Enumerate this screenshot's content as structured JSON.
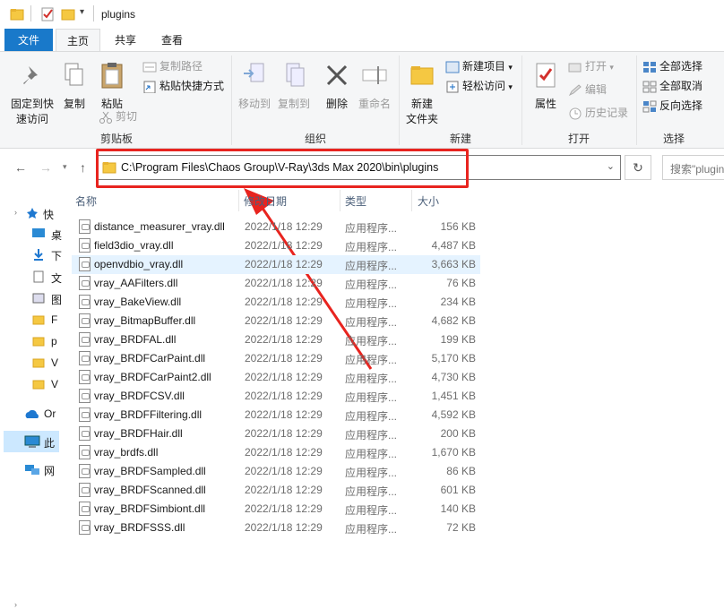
{
  "window": {
    "title": "plugins"
  },
  "tabs": {
    "file": "文件",
    "home": "主页",
    "share": "共享",
    "view": "查看"
  },
  "ribbon": {
    "pin": "固定到快\n速访问",
    "copy": "复制",
    "paste": "粘贴",
    "copy_path": "复制路径",
    "paste_shortcut": "粘贴快捷方式",
    "cut": "剪切",
    "group_clipboard": "剪贴板",
    "move_to": "移动到",
    "copy_to": "复制到",
    "delete": "删除",
    "rename": "重命名",
    "group_organize": "组织",
    "new_item": "新建项目",
    "easy_access": "轻松访问",
    "new_folder": "新建\n文件夹",
    "group_new": "新建",
    "properties": "属性",
    "open": "打开",
    "edit": "编辑",
    "history": "历史记录",
    "group_open": "打开",
    "select_all": "全部选择",
    "select_none": "全部取消",
    "invert_selection": "反向选择",
    "group_select": "选择"
  },
  "address": {
    "path": "C:\\Program Files\\Chaos Group\\V-Ray\\3ds Max 2020\\bin\\plugins"
  },
  "search": {
    "placeholder": "搜索\"plugins\""
  },
  "nav": {
    "items": [
      "快",
      "桌",
      "下",
      "文",
      "图",
      "F",
      "p",
      "V",
      "V",
      "Or",
      "此",
      "网"
    ]
  },
  "columns": {
    "name": "名称",
    "date": "修改日期",
    "type": "类型",
    "size": "大小"
  },
  "files": [
    {
      "name": "distance_measurer_vray.dll",
      "date": "2022/1/18 12:29",
      "type": "应用程序...",
      "size": "156 KB"
    },
    {
      "name": "field3dio_vray.dll",
      "date": "2022/1/18 12:29",
      "type": "应用程序...",
      "size": "4,487 KB"
    },
    {
      "name": "openvdbio_vray.dll",
      "date": "2022/1/18 12:29",
      "type": "应用程序...",
      "size": "3,663 KB"
    },
    {
      "name": "vray_AAFilters.dll",
      "date": "2022/1/18 12:29",
      "type": "应用程序...",
      "size": "76 KB"
    },
    {
      "name": "vray_BakeView.dll",
      "date": "2022/1/18 12:29",
      "type": "应用程序...",
      "size": "234 KB"
    },
    {
      "name": "vray_BitmapBuffer.dll",
      "date": "2022/1/18 12:29",
      "type": "应用程序...",
      "size": "4,682 KB"
    },
    {
      "name": "vray_BRDFAL.dll",
      "date": "2022/1/18 12:29",
      "type": "应用程序...",
      "size": "199 KB"
    },
    {
      "name": "vray_BRDFCarPaint.dll",
      "date": "2022/1/18 12:29",
      "type": "应用程序...",
      "size": "5,170 KB"
    },
    {
      "name": "vray_BRDFCarPaint2.dll",
      "date": "2022/1/18 12:29",
      "type": "应用程序...",
      "size": "4,730 KB"
    },
    {
      "name": "vray_BRDFCSV.dll",
      "date": "2022/1/18 12:29",
      "type": "应用程序...",
      "size": "1,451 KB"
    },
    {
      "name": "vray_BRDFFiltering.dll",
      "date": "2022/1/18 12:29",
      "type": "应用程序...",
      "size": "4,592 KB"
    },
    {
      "name": "vray_BRDFHair.dll",
      "date": "2022/1/18 12:29",
      "type": "应用程序...",
      "size": "200 KB"
    },
    {
      "name": "vray_brdfs.dll",
      "date": "2022/1/18 12:29",
      "type": "应用程序...",
      "size": "1,670 KB"
    },
    {
      "name": "vray_BRDFSampled.dll",
      "date": "2022/1/18 12:29",
      "type": "应用程序...",
      "size": "86 KB"
    },
    {
      "name": "vray_BRDFScanned.dll",
      "date": "2022/1/18 12:29",
      "type": "应用程序...",
      "size": "601 KB"
    },
    {
      "name": "vray_BRDFSimbiont.dll",
      "date": "2022/1/18 12:29",
      "type": "应用程序...",
      "size": "140 KB"
    },
    {
      "name": "vray_BRDFSSS.dll",
      "date": "2022/1/18 12:29",
      "type": "应用程序...",
      "size": "72 KB"
    }
  ],
  "selected_row": 2,
  "colors": {
    "accent": "#1979ca",
    "annotation": "#e8241f",
    "selection": "#e5f3ff"
  }
}
